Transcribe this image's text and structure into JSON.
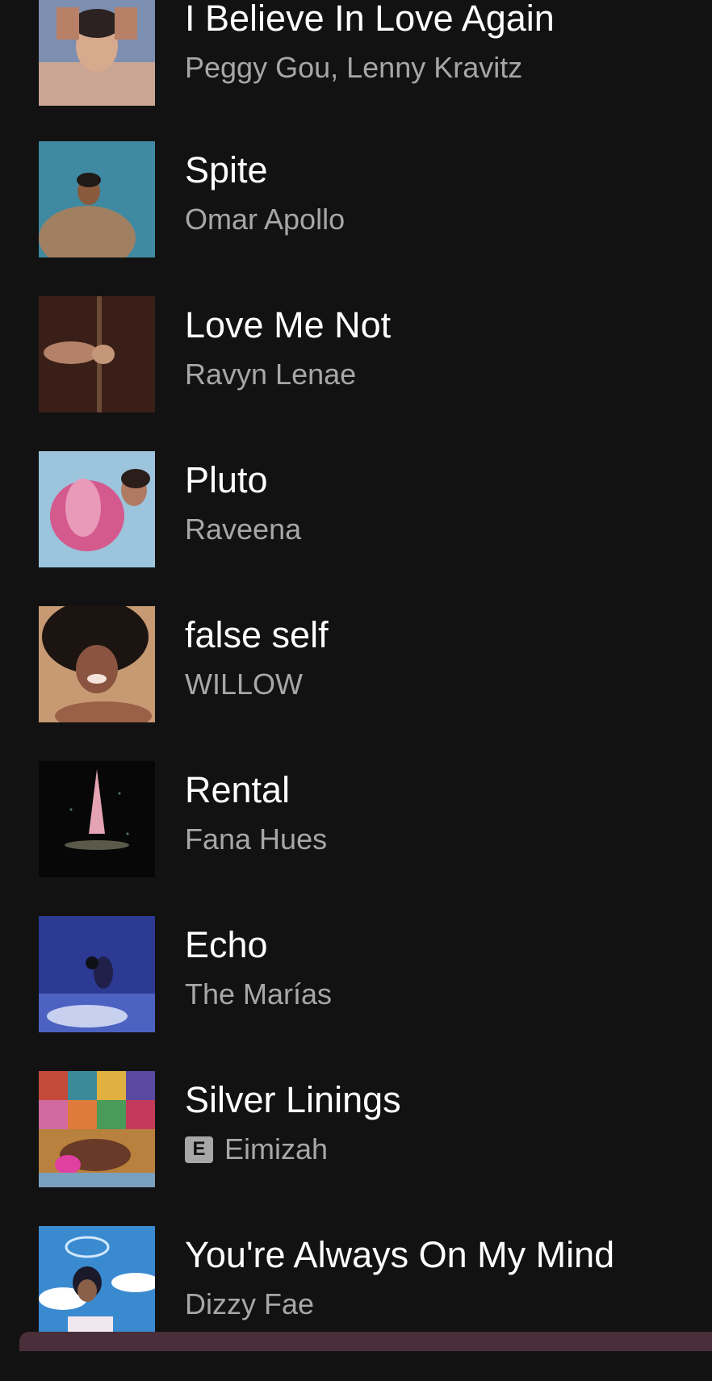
{
  "tracks": [
    {
      "title": "I Believe In Love Again",
      "artist": "Peggy Gou, Lenny Kravitz",
      "explicit": false,
      "cover_icon": "album-art"
    },
    {
      "title": "Spite",
      "artist": "Omar Apollo",
      "explicit": false,
      "cover_icon": "album-art"
    },
    {
      "title": "Love Me Not",
      "artist": "Ravyn Lenae",
      "explicit": false,
      "cover_icon": "album-art"
    },
    {
      "title": "Pluto",
      "artist": "Raveena",
      "explicit": false,
      "cover_icon": "album-art"
    },
    {
      "title": "false self",
      "artist": "WILLOW",
      "explicit": false,
      "cover_icon": "album-art"
    },
    {
      "title": "Rental",
      "artist": "Fana Hues",
      "explicit": false,
      "cover_icon": "album-art"
    },
    {
      "title": "Echo",
      "artist": "The Marías",
      "explicit": false,
      "cover_icon": "album-art"
    },
    {
      "title": "Silver Linings",
      "artist": "Eimizah",
      "explicit": true,
      "explicit_label": "E",
      "cover_icon": "album-art"
    },
    {
      "title": "You're Always On My Mind",
      "artist": "Dizzy Fae",
      "explicit": false,
      "cover_icon": "album-art"
    }
  ],
  "colors": {
    "background": "#121212",
    "title": "#ffffff",
    "artist": "#a7a7a7",
    "mini_player": "#4a2e3a"
  }
}
